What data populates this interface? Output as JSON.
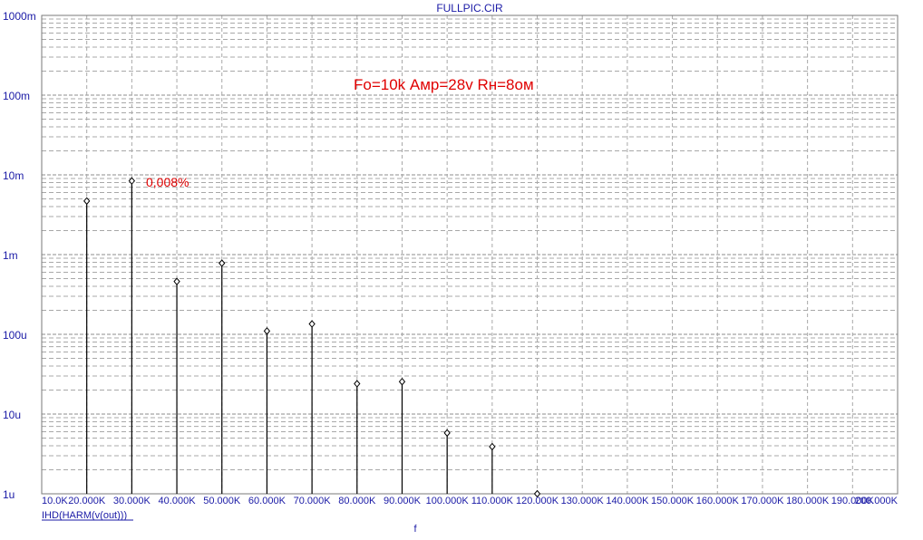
{
  "window": {
    "title": "FULLPIC.CIR"
  },
  "chart_data": {
    "type": "bar",
    "title": "FULLPIC.CIR",
    "xlabel": "f",
    "ylabel": "",
    "series_name": "IHD(HARM(v(out)))",
    "y_scale": "log",
    "ylim": [
      1e-06,
      1
    ],
    "y_ticks": [
      "1000m",
      "100m",
      "10m",
      "1m",
      "100u",
      "10u",
      "1u"
    ],
    "xlim": [
      10000,
      200000
    ],
    "x_ticks": [
      "10.0K",
      "20.000K",
      "30.000K",
      "40.000K",
      "50.000K",
      "60.000K",
      "70.000K",
      "80.000K",
      "90.000K",
      "100.000K",
      "110.000K",
      "120.000K",
      "130.000K",
      "140.000K",
      "150.000K",
      "160.000K",
      "170.000K",
      "180.000K",
      "190.000K",
      "200.000K"
    ],
    "grid": true,
    "series": [
      {
        "name": "IHD(HARM(v(out)))",
        "x": [
          20000,
          30000,
          40000,
          50000,
          60000,
          70000,
          80000,
          90000,
          100000,
          110000,
          120000
        ],
        "values": [
          0.0047,
          0.0084,
          0.00046,
          0.00078,
          0.00011,
          0.000135,
          2.4e-05,
          2.55e-05,
          5.8e-06,
          3.9e-06,
          1e-06
        ]
      }
    ],
    "annotations": [
      {
        "text": "Fo=10k Амр=28v Rн=8ом"
      },
      {
        "text": "0,008%"
      }
    ]
  },
  "colors": {
    "axis": "#1a1aa6",
    "grid": "#8c8c8c",
    "stem": "#000000",
    "annotation": "#e00000"
  }
}
